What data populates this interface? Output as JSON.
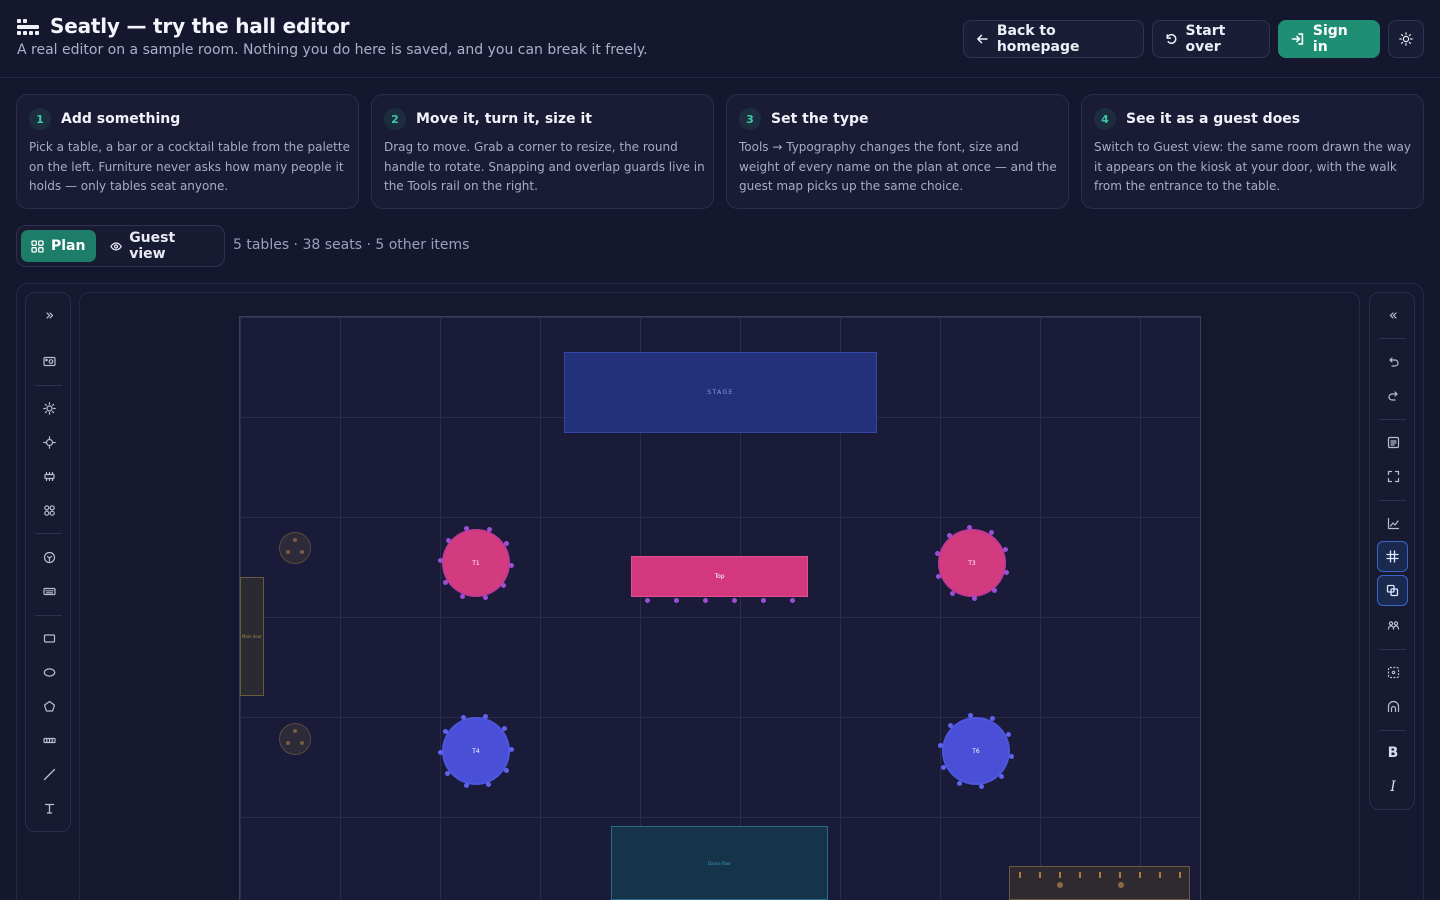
{
  "header": {
    "title": "Seatly — try the hall editor",
    "subtitle": "A real editor on a sample room. Nothing you do here is saved, and you can break it freely.",
    "back_label": "Back to homepage",
    "start_over_label": "Start over",
    "sign_in_label": "Sign in",
    "accent": "#1f8f74"
  },
  "steps": [
    {
      "num": "1",
      "title": "Add something",
      "body": "Pick a table, a bar or a cocktail table from the palette on the left. Furniture never asks how many people it holds — only tables seat anyone."
    },
    {
      "num": "2",
      "title": "Move it, turn it, size it",
      "body": "Drag to move. Grab a corner to resize, the round handle to rotate. Snapping and overlap guards live in the Tools rail on the right."
    },
    {
      "num": "3",
      "title": "Set the type",
      "body": "Tools → Typography changes the font, size and weight of every name on the plan at once — and the guest map picks up the same choice."
    },
    {
      "num": "4",
      "title": "See it as a guest does",
      "body": "Switch to Guest view: the same room drawn the way it appears on the kiosk at your door, with the walk from the entrance to the table."
    }
  ],
  "modes": {
    "plan": "Plan",
    "guest": "Guest view"
  },
  "summary": "5 tables · 38 seats · 5 other items",
  "room": {
    "stage_label": "STAGE",
    "tables": {
      "t1": "T1",
      "top": "Top",
      "t3": "T3",
      "t4": "T4",
      "t6": "T6"
    },
    "main_door_label": "Main door",
    "dance_floor_label": "Dance floor",
    "colors": {
      "table_pink": "#d33b7f",
      "table_blue": "#4a4fd8",
      "stage": "#23307a"
    }
  },
  "rails": {
    "left_tools": [
      "expand-icon",
      "camera-icon",
      "sun-icon",
      "crosshair-icon",
      "banquet-icon",
      "grid-icon",
      "smile-icon",
      "keyboard-icon",
      "rectangle-icon",
      "ellipse-icon",
      "pentagon-icon",
      "strip-icon",
      "line-icon",
      "text-icon"
    ],
    "right_tools": [
      "collapse-icon",
      "undo-icon",
      "redo-icon",
      "list-icon",
      "fullscreen-icon",
      "chart-icon",
      "snap-grid-icon",
      "overlap-icon",
      "group-icon",
      "select-icon",
      "arch-icon",
      "bold-icon",
      "italic-icon"
    ],
    "bold_label": "B",
    "italic_label": "I"
  }
}
